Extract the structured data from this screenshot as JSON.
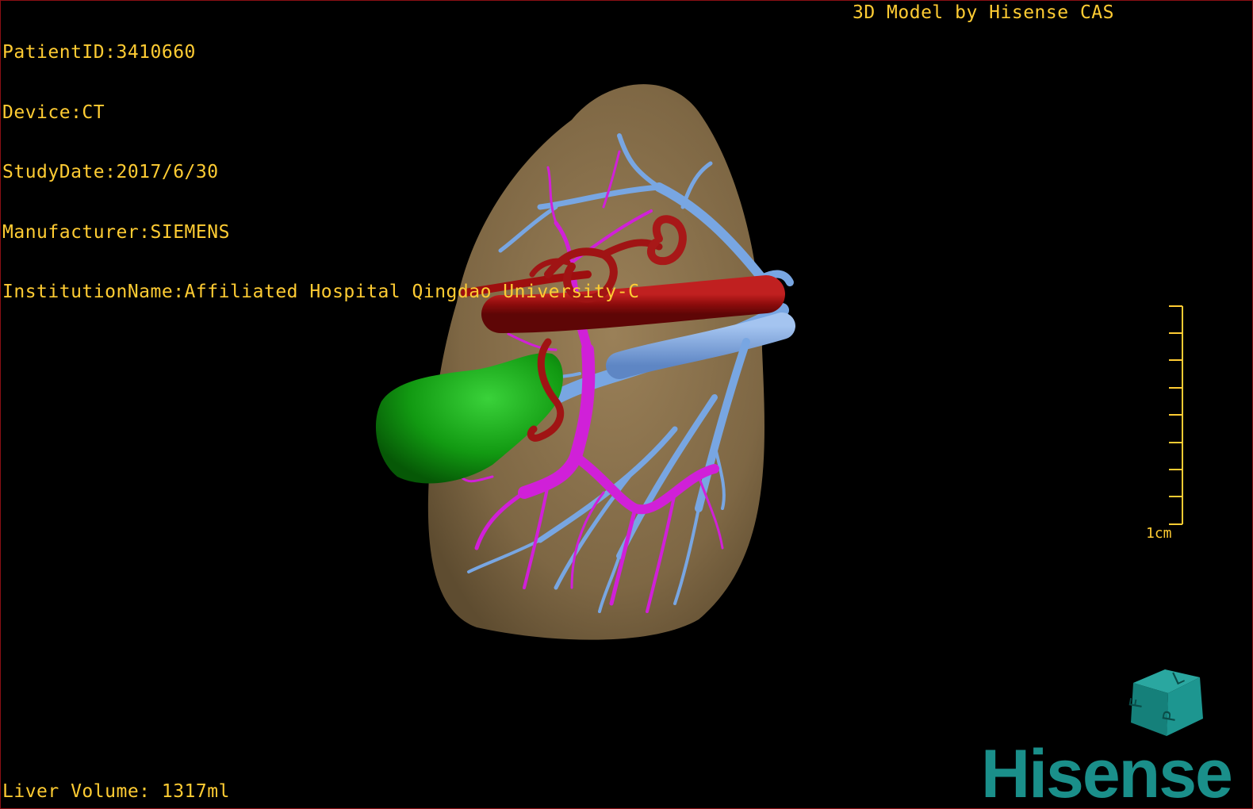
{
  "viewer": {
    "title": "3D Model by Hisense CAS",
    "patient_id_line": "PatientID:3410660",
    "device_line": "Device:CT",
    "study_date_line": "StudyDate:2017/6/30",
    "manufacturer_line": "Manufacturer:SIEMENS",
    "institution_line": "InstitutionName:Affiliated Hospital Qingdao University-C",
    "liver_volume_line": "Liver Volume: 1317ml",
    "scale_label": "1cm",
    "brand": "Hisense"
  },
  "orientation_cube": {
    "face_left_letter": "F",
    "face_right_letter": "P",
    "face_top_letter": "L",
    "color": "#1a8f8a"
  },
  "colors": {
    "overlay_text": "#ffcc33",
    "liver": "#8a7250",
    "gallbladder": "#16a016",
    "hepatic_artery": "#9e0f0f",
    "portal_vein": "#d020d8",
    "hepatic_vein": "#78a6e2",
    "frame": "#8a0f14"
  }
}
